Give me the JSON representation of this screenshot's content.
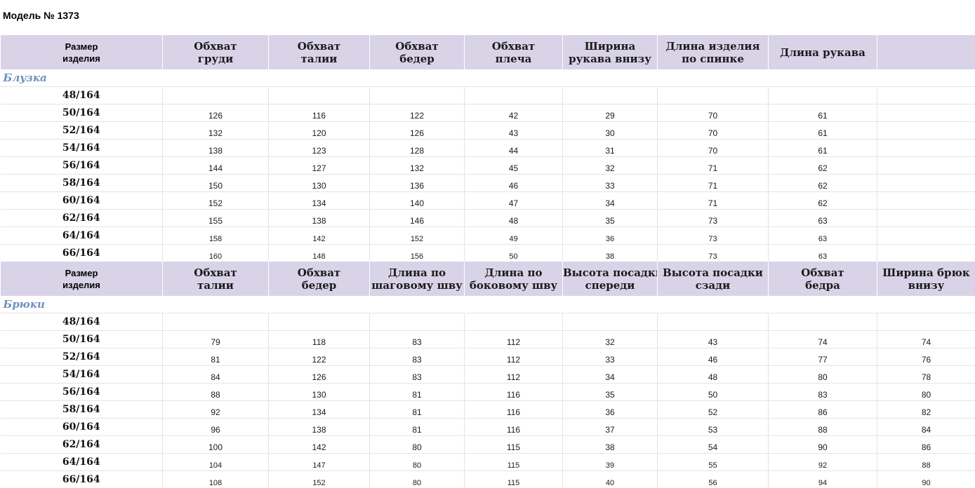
{
  "title": "Модель №  1373",
  "blouse": {
    "section_label": "Блузка",
    "headers": [
      [
        "Размер",
        "изделия"
      ],
      [
        "Обхват",
        "груди"
      ],
      [
        "Обхват",
        "талии"
      ],
      [
        "Обхват",
        "бедер"
      ],
      [
        "Обхват",
        "плеча"
      ],
      [
        "Ширина",
        "рукава внизу"
      ],
      [
        "Длина изделия",
        "по спинке"
      ],
      [
        "Длина рукава",
        ""
      ],
      [
        "",
        ""
      ]
    ],
    "rows": [
      [
        "48/164",
        "",
        "",
        "",
        "",
        "",
        "",
        "",
        ""
      ],
      [
        "50/164",
        "126",
        "116",
        "122",
        "42",
        "29",
        "70",
        "61",
        ""
      ],
      [
        "52/164",
        "132",
        "120",
        "126",
        "43",
        "30",
        "70",
        "61",
        ""
      ],
      [
        "54/164",
        "138",
        "123",
        "128",
        "44",
        "31",
        "70",
        "61",
        ""
      ],
      [
        "56/164",
        "144",
        "127",
        "132",
        "45",
        "32",
        "71",
        "62",
        ""
      ],
      [
        "58/164",
        "150",
        "130",
        "136",
        "46",
        "33",
        "71",
        "62",
        ""
      ],
      [
        "60/164",
        "152",
        "134",
        "140",
        "47",
        "34",
        "71",
        "62",
        ""
      ],
      [
        "62/164",
        "155",
        "138",
        "146",
        "48",
        "35",
        "73",
        "63",
        ""
      ],
      [
        "64/164",
        "158",
        "142",
        "152",
        "49",
        "36",
        "73",
        "63",
        ""
      ],
      [
        "66/164",
        "160",
        "148",
        "156",
        "50",
        "38",
        "73",
        "63",
        ""
      ]
    ]
  },
  "pants": {
    "section_label": "Брюки",
    "headers": [
      [
        "Размер",
        "изделия"
      ],
      [
        "Обхват",
        "талии"
      ],
      [
        "Обхват",
        "бедер"
      ],
      [
        "Длина по",
        "шаговому шву"
      ],
      [
        "Длина по",
        "боковому шву"
      ],
      [
        "Высота посадки",
        "спереди"
      ],
      [
        "Высота посадки",
        "сзади"
      ],
      [
        "Обхват",
        "бедра"
      ],
      [
        "Ширина брюк",
        "внизу"
      ]
    ],
    "rows": [
      [
        "48/164",
        "",
        "",
        "",
        "",
        "",
        "",
        "",
        ""
      ],
      [
        "50/164",
        "79",
        "118",
        "83",
        "112",
        "32",
        "43",
        "74",
        "74"
      ],
      [
        "52/164",
        "81",
        "122",
        "83",
        "112",
        "33",
        "46",
        "77",
        "76"
      ],
      [
        "54/164",
        "84",
        "126",
        "83",
        "112",
        "34",
        "48",
        "80",
        "78"
      ],
      [
        "56/164",
        "88",
        "130",
        "81",
        "116",
        "35",
        "50",
        "83",
        "80"
      ],
      [
        "58/164",
        "92",
        "134",
        "81",
        "116",
        "36",
        "52",
        "86",
        "82"
      ],
      [
        "60/164",
        "96",
        "138",
        "81",
        "116",
        "37",
        "53",
        "88",
        "84"
      ],
      [
        "62/164",
        "100",
        "142",
        "80",
        "115",
        "38",
        "54",
        "90",
        "86"
      ],
      [
        "64/164",
        "104",
        "147",
        "80",
        "115",
        "39",
        "55",
        "92",
        "88"
      ],
      [
        "66/164",
        "108",
        "152",
        "80",
        "115",
        "40",
        "56",
        "94",
        "90"
      ]
    ]
  }
}
